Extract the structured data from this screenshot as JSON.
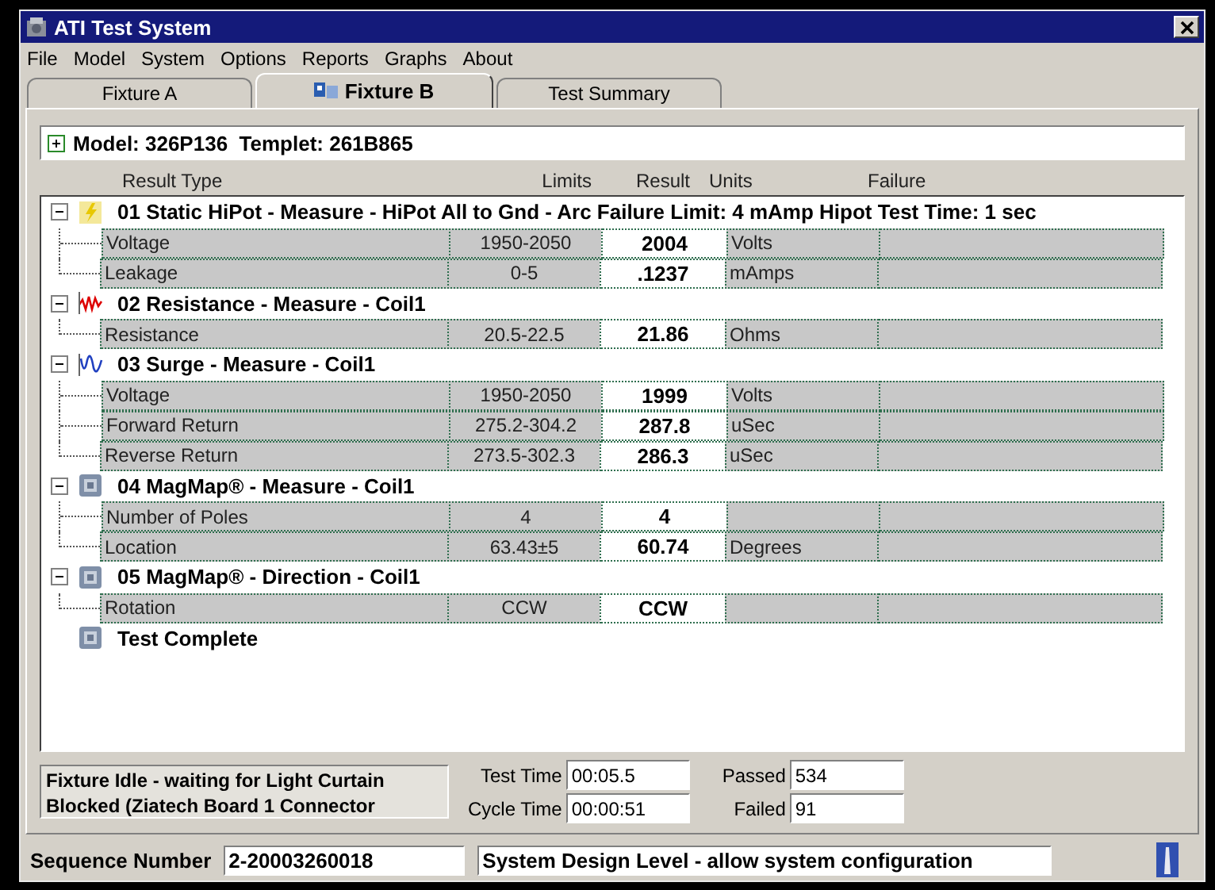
{
  "window": {
    "title": "ATI Test System"
  },
  "menu": [
    "File",
    "Model",
    "System",
    "Options",
    "Reports",
    "Graphs",
    "About"
  ],
  "tabs": [
    {
      "label": "Fixture A",
      "selected": false
    },
    {
      "label": "Fixture B",
      "selected": true
    },
    {
      "label": "Test Summary",
      "selected": false
    }
  ],
  "model": {
    "expanded": false,
    "label": "Model: 326P136  Templet: 261B865"
  },
  "columns": [
    "Result Type",
    "Limits",
    "Result",
    "Units",
    "Failure"
  ],
  "tests": [
    {
      "kind": "hipot",
      "title": "01 Static HiPot - Measure - HiPot All to Gnd - Arc Failure Limit: 4 mAmp Hipot Test Time: 1 sec",
      "expanded": true,
      "children": [
        {
          "name": "Voltage",
          "limits": "1950-2050",
          "result": "2004",
          "units": "Volts"
        },
        {
          "name": "Leakage",
          "limits": "0-5",
          "result": ".1237",
          "units": "mAmps"
        }
      ]
    },
    {
      "kind": "resistance",
      "title": "02 Resistance - Measure - Coil1",
      "expanded": true,
      "children": [
        {
          "name": "Resistance",
          "limits": "20.5-22.5",
          "result": "21.86",
          "units": "Ohms"
        }
      ]
    },
    {
      "kind": "surge",
      "title": "03 Surge - Measure - Coil1",
      "expanded": true,
      "children": [
        {
          "name": "Voltage",
          "limits": "1950-2050",
          "result": "1999",
          "units": "Volts"
        },
        {
          "name": "Forward Return",
          "limits": "275.2-304.2",
          "result": "287.8",
          "units": "uSec"
        },
        {
          "name": "Reverse Return",
          "limits": "273.5-302.3",
          "result": "286.3",
          "units": "uSec"
        }
      ]
    },
    {
      "kind": "magmap",
      "title": "04 MagMap® - Measure - Coil1",
      "expanded": true,
      "children": [
        {
          "name": "Number of Poles",
          "limits": "4",
          "result": "4"
        },
        {
          "name": "Location",
          "limits": "63.43±5",
          "result": "60.74",
          "units": "Degrees"
        }
      ]
    },
    {
      "kind": "magmap",
      "title": "05 MagMap® - Direction - Coil1",
      "expanded": true,
      "children": [
        {
          "name": "Rotation",
          "limits": "CCW",
          "result": "CCW"
        }
      ]
    },
    {
      "kind": "magmap",
      "title": "Test Complete"
    }
  ],
  "status": {
    "message": "Fixture Idle - waiting for Light Curtain Blocked (Ziatech Board 1 Connector",
    "test_time_label": "Test Time",
    "test_time": "00:05.5",
    "cycle_time_label": "Cycle Time",
    "cycle_time": "00:00:51",
    "passed_label": "Passed",
    "passed": "534",
    "failed_label": "Failed",
    "failed": "91"
  },
  "status_bar": {
    "sequence_label": "Sequence Number",
    "sequence_number": "2-20003260018",
    "level": "System Design Level - allow system configuration"
  }
}
